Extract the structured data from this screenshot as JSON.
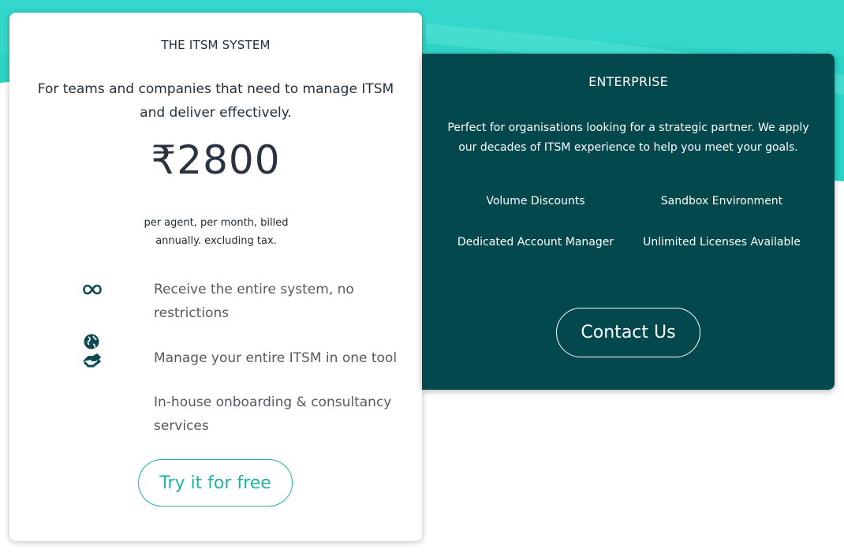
{
  "colors": {
    "accent": "#22b3a0",
    "background_teal": "#2dd4c5",
    "enterprise_bg": "#03484d",
    "icon": "#0e4a52"
  },
  "itsm_card": {
    "title": "THE ITSM SYSTEM",
    "description": "For teams and companies that need to manage ITSM and deliver effectively.",
    "price": "₹2800",
    "billing_note": "per agent, per month, billed annually. excluding tax.",
    "features": [
      {
        "icon": "infinity-icon",
        "text": "Receive the entire system, no restrictions"
      },
      {
        "icon": "globe-handshake-icon",
        "text": "Manage your entire ITSM in one tool"
      },
      {
        "icon": "",
        "text": "In-house onboarding & consultancy services"
      }
    ],
    "cta_label": "Try it for free"
  },
  "enterprise_card": {
    "title": "ENTERPRISE",
    "description": "Perfect for organisations looking for a strategic partner. We apply our decades of ITSM experience to help you meet your goals.",
    "features": [
      "Volume Discounts",
      "Sandbox Environment",
      "Dedicated Account Manager",
      "Unlimited Licenses Available"
    ],
    "cta_label": "Contact Us"
  }
}
